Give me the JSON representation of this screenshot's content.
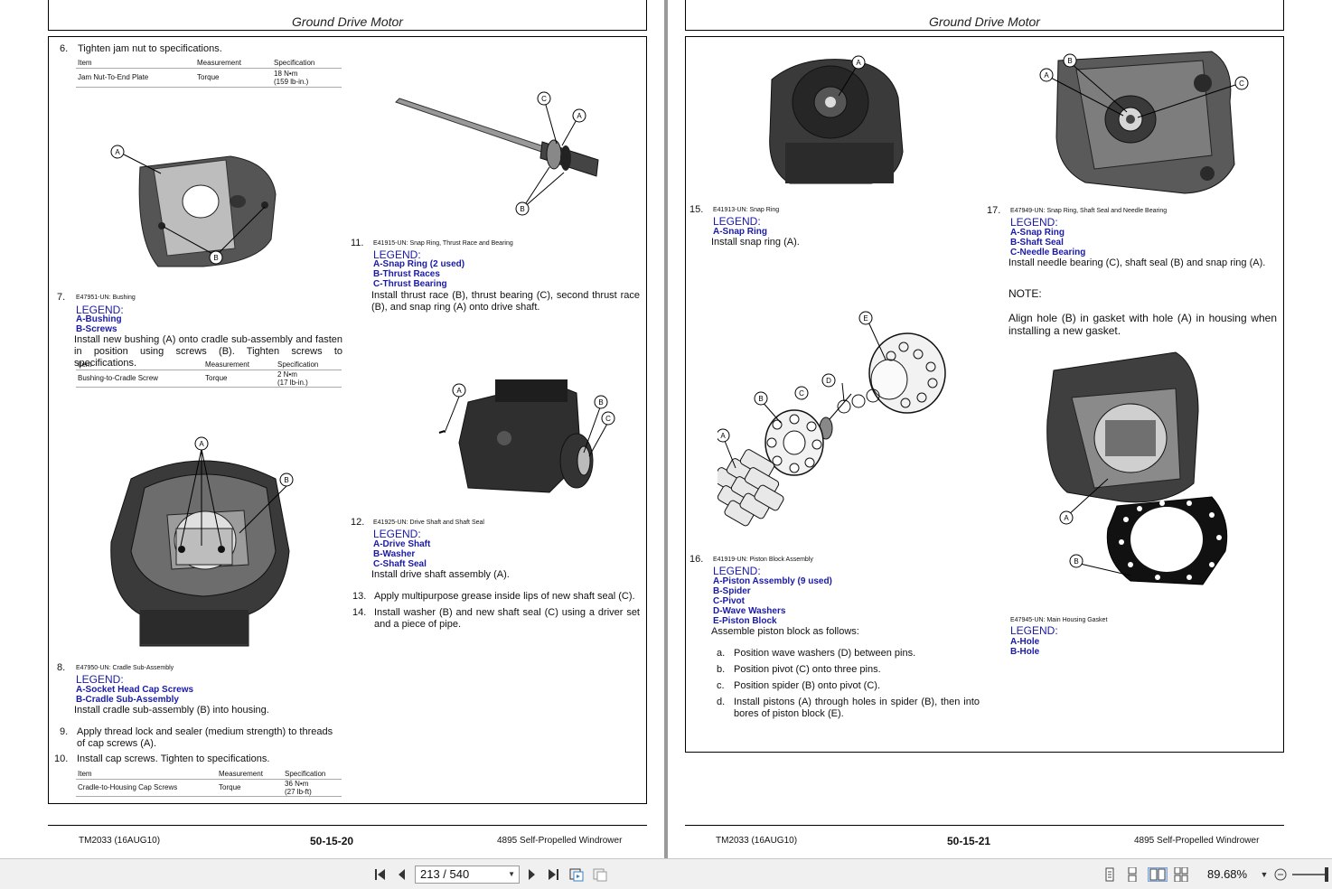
{
  "left_page": {
    "header": "Ground Drive Motor",
    "footer": {
      "doc": "TM2033 (16AUG10)",
      "page": "50-15-20",
      "product": "4895 Self-Propelled Windrower"
    },
    "step6": {
      "num": "6.",
      "text": "Tighten jam nut to specifications.",
      "table": {
        "h1": "Item",
        "h2": "Measurement",
        "h3": "Specification",
        "c1": "Jam Nut-To-End Plate",
        "c2": "Torque",
        "c3a": "18 N•m",
        "c3b": "(159 lb-in.)"
      }
    },
    "step7": {
      "num": "7.",
      "fig": "E47951-UN: Bushing",
      "legend": "LEGEND:",
      "items": [
        "A-Bushing",
        "B-Screws"
      ],
      "text": "Install new bushing (A) onto cradle sub-assembly and fasten in position using screws (B). Tighten screws to specifications.",
      "table": {
        "h1": "Item",
        "h2": "Measurement",
        "h3": "Specification",
        "c1": "Bushing-to-Cradle Screw",
        "c2": "Torque",
        "c3a": "2 N•m",
        "c3b": "(17 lb-in.)"
      }
    },
    "step8": {
      "num": "8.",
      "fig": "E47950-UN: Cradle Sub-Assembly",
      "legend": "LEGEND:",
      "items": [
        "A-Socket Head Cap Screws",
        "B-Cradle Sub-Assembly"
      ],
      "text": "Install cradle sub-assembly (B) into housing."
    },
    "step9": {
      "num": "9.",
      "text": "Apply thread lock and sealer (medium strength) to threads of cap screws (A)."
    },
    "step10": {
      "num": "10.",
      "text": "Install cap screws. Tighten to specifications.",
      "table": {
        "h1": "Item",
        "h2": "Measurement",
        "h3": "Specification",
        "c1": "Cradle-to-Housing Cap Screws",
        "c2": "Torque",
        "c3a": "36 N•m",
        "c3b": "(27 lb-ft)"
      }
    },
    "step11": {
      "num": "11.",
      "fig": "E41915-UN: Snap Ring, Thrust Race and Bearing",
      "legend": "LEGEND:",
      "items": [
        "A-Snap Ring (2 used)",
        "B-Thrust Races",
        "C-Thrust Bearing"
      ],
      "text": "Install thrust race (B), thrust bearing (C), second thrust race (B), and snap ring (A) onto drive shaft."
    },
    "step12": {
      "num": "12.",
      "fig": "E41925-UN: Drive Shaft and Shaft Seal",
      "legend": "LEGEND:",
      "items": [
        "A-Drive Shaft",
        "B-Washer",
        "C-Shaft Seal"
      ],
      "text": "Install drive shaft assembly (A)."
    },
    "step13": {
      "num": "13.",
      "text": "Apply multipurpose grease inside lips of new shaft seal (C)."
    },
    "step14": {
      "num": "14.",
      "text": "Install washer (B) and new shaft seal (C) using a driver set and a piece of pipe."
    },
    "callouts": {
      "a": "A",
      "b": "B",
      "c": "C"
    }
  },
  "right_page": {
    "header": "Ground Drive Motor",
    "footer": {
      "doc": "TM2033 (16AUG10)",
      "page": "50-15-21",
      "product": "4895 Self-Propelled Windrower"
    },
    "step15": {
      "num": "15.",
      "fig": "E41913-UN: Snap Ring",
      "legend": "LEGEND:",
      "items": [
        "A-Snap Ring"
      ],
      "text": "Install snap ring (A)."
    },
    "step16": {
      "num": "16.",
      "fig": "E41919-UN: Piston Block Assembly",
      "legend": "LEGEND:",
      "items": [
        "A-Piston Assembly (9 used)",
        "B-Spider",
        "C-Pivot",
        "D-Wave Washers",
        "E-Piston Block"
      ],
      "text": "Assemble piston block as follows:",
      "substeps": [
        {
          "label": "a.",
          "text": "Position wave washers (D) between pins."
        },
        {
          "label": "b.",
          "text": "Position pivot (C) onto three pins."
        },
        {
          "label": "c.",
          "text": "Position spider (B) onto pivot (C)."
        },
        {
          "label": "d.",
          "text": "Install pistons (A) through holes in spider (B), then into bores of piston block (E)."
        }
      ]
    },
    "step17": {
      "num": "17.",
      "fig": "E47949-UN: Snap Ring, Shaft Seal and Needle Bearing",
      "legend": "LEGEND:",
      "items": [
        "A-Snap Ring",
        "B-Shaft Seal",
        "C-Needle Bearing"
      ],
      "text": "Install needle bearing (C), shaft seal (B) and snap ring (A)."
    },
    "note": {
      "label": "NOTE:",
      "text": "Align hole (B) in gasket with hole (A) in housing when installing a new gasket."
    },
    "gasket": {
      "fig": "E47945-UN: Main Housing Gasket",
      "legend": "LEGEND:",
      "items": [
        "A-Hole",
        "B-Hole"
      ]
    },
    "callouts": {
      "a": "A",
      "b": "B",
      "c": "C",
      "d": "D",
      "e": "E"
    }
  },
  "toolbar": {
    "page_display": "213 / 540",
    "current_page": 213,
    "total_pages": 540,
    "zoom": "89.68%"
  }
}
